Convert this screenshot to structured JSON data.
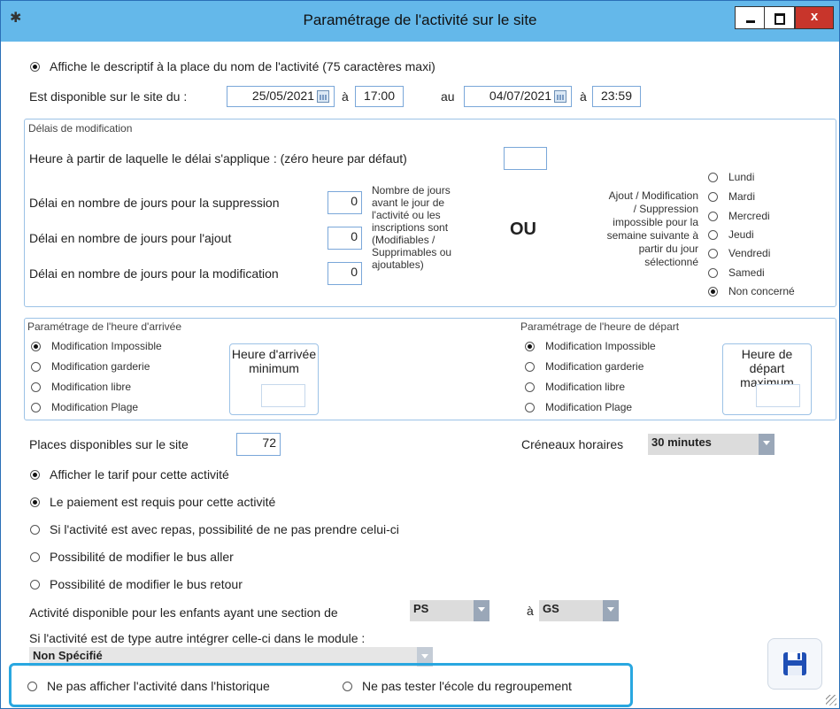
{
  "window": {
    "title": "Paramétrage de l'activité sur le site",
    "close_label": "x"
  },
  "top": {
    "show_descriptif": "Affiche le descriptif à la place du nom de l'activité (75 caractères maxi)",
    "available_label": "Est disponible sur le site du :",
    "start_date": "25/05/2021",
    "a_label": "à",
    "start_time": "17:00",
    "au_label": "au",
    "end_date": "04/07/2021",
    "end_time": "23:59"
  },
  "delais": {
    "title": "Délais de modification",
    "hour_label": "Heure à partir de laquelle le délai s'applique : (zéro heure par défaut)",
    "hour_value": "",
    "suppression_label": "Délai en nombre de jours pour la suppression",
    "suppression_value": "0",
    "ajout_label": "Délai en nombre de jours pour l'ajout",
    "ajout_value": "0",
    "modification_label": "Délai en nombre de jours pour la modification",
    "modification_value": "0",
    "note": [
      "Nombre de jours",
      "avant le jour de",
      "l'activité ou les",
      "inscriptions sont",
      "(Modifiables /",
      "Supprimables ou",
      "ajoutables)"
    ],
    "ou": "OU",
    "right_note": [
      "Ajout / Modification",
      "/ Suppression",
      "impossible pour la",
      "semaine suivante à",
      "partir du jour",
      "sélectionné"
    ],
    "days": [
      "Lundi",
      "Mardi",
      "Mercredi",
      "Jeudi",
      "Vendredi",
      "Samedi",
      "Non concerné"
    ],
    "selected_day": "Non concerné"
  },
  "arrivee": {
    "title": "Paramétrage de l'heure d'arrivée",
    "options": [
      "Modification Impossible",
      "Modification garderie",
      "Modification libre",
      "Modification Plage"
    ],
    "box_line1": "Heure d'arrivée",
    "box_line2": "minimum"
  },
  "depart": {
    "title": "Paramétrage de l'heure de départ",
    "options": [
      "Modification Impossible",
      "Modification garderie",
      "Modification libre",
      "Modification Plage"
    ],
    "box_line1": "Heure de départ",
    "box_line2": "maximum"
  },
  "places": {
    "label": "Places disponibles sur le site",
    "value": "72"
  },
  "creneaux": {
    "label": "Créneaux horaires",
    "value": "30 minutes"
  },
  "options": [
    {
      "label": "Afficher le tarif pour cette activité",
      "checked": true
    },
    {
      "label": "Le paiement est requis pour cette activité",
      "checked": true
    },
    {
      "label": "Si l'activité est avec repas, possibilité de ne pas prendre celui-ci",
      "checked": false
    },
    {
      "label": "Possibilité de modifier le bus aller",
      "checked": false
    },
    {
      "label": "Possibilité de modifier le bus retour",
      "checked": false
    }
  ],
  "section": {
    "label": "Activité disponible pour les enfants ayant une section de",
    "from": "PS",
    "a_label": "à",
    "to": "GS"
  },
  "module": {
    "label": "Si l'activité est de type autre intégrer celle-ci dans le module :",
    "value": "Non Spécifié"
  },
  "bottom": {
    "no_history": "Ne pas afficher l'activité dans l'historique",
    "no_school_test": "Ne pas tester l'école du regroupement"
  },
  "colors": {
    "titlebar": "#64b8ea",
    "highlight": "#29a7e0",
    "close": "#c8352b"
  }
}
